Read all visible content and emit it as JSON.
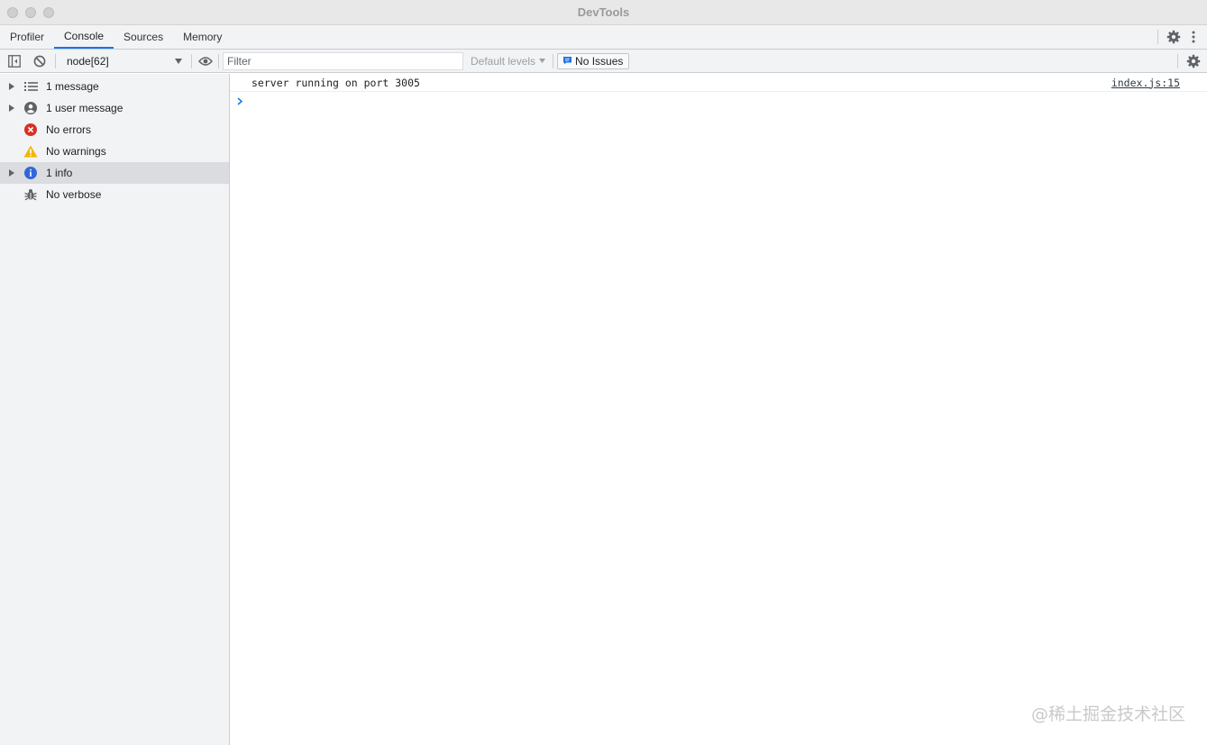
{
  "window": {
    "title": "DevTools"
  },
  "tabs": [
    {
      "label": "Profiler",
      "active": false
    },
    {
      "label": "Console",
      "active": true
    },
    {
      "label": "Sources",
      "active": false
    },
    {
      "label": "Memory",
      "active": false
    }
  ],
  "toolbar": {
    "context": "node[62]",
    "filter_placeholder": "Filter",
    "levels_label": "Default levels",
    "issues_label": "No Issues"
  },
  "sidebar": {
    "items": [
      {
        "label": "1 message",
        "icon": "list-icon",
        "expandable": true
      },
      {
        "label": "1 user message",
        "icon": "user-circle-icon",
        "expandable": true
      },
      {
        "label": "No errors",
        "icon": "error-icon",
        "expandable": false
      },
      {
        "label": "No warnings",
        "icon": "warning-icon",
        "expandable": false
      },
      {
        "label": "1 info",
        "icon": "info-icon",
        "expandable": true,
        "selected": true
      },
      {
        "label": "No verbose",
        "icon": "bug-icon",
        "expandable": false
      }
    ]
  },
  "console": {
    "messages": [
      {
        "text": "server running on port 3005",
        "source": "index.js:15"
      }
    ]
  },
  "watermark": "@稀土掘金技术社区",
  "colors": {
    "accent": "#1a73e8",
    "error": "#d93025",
    "warning": "#f2b600",
    "info": "#3367d6"
  }
}
